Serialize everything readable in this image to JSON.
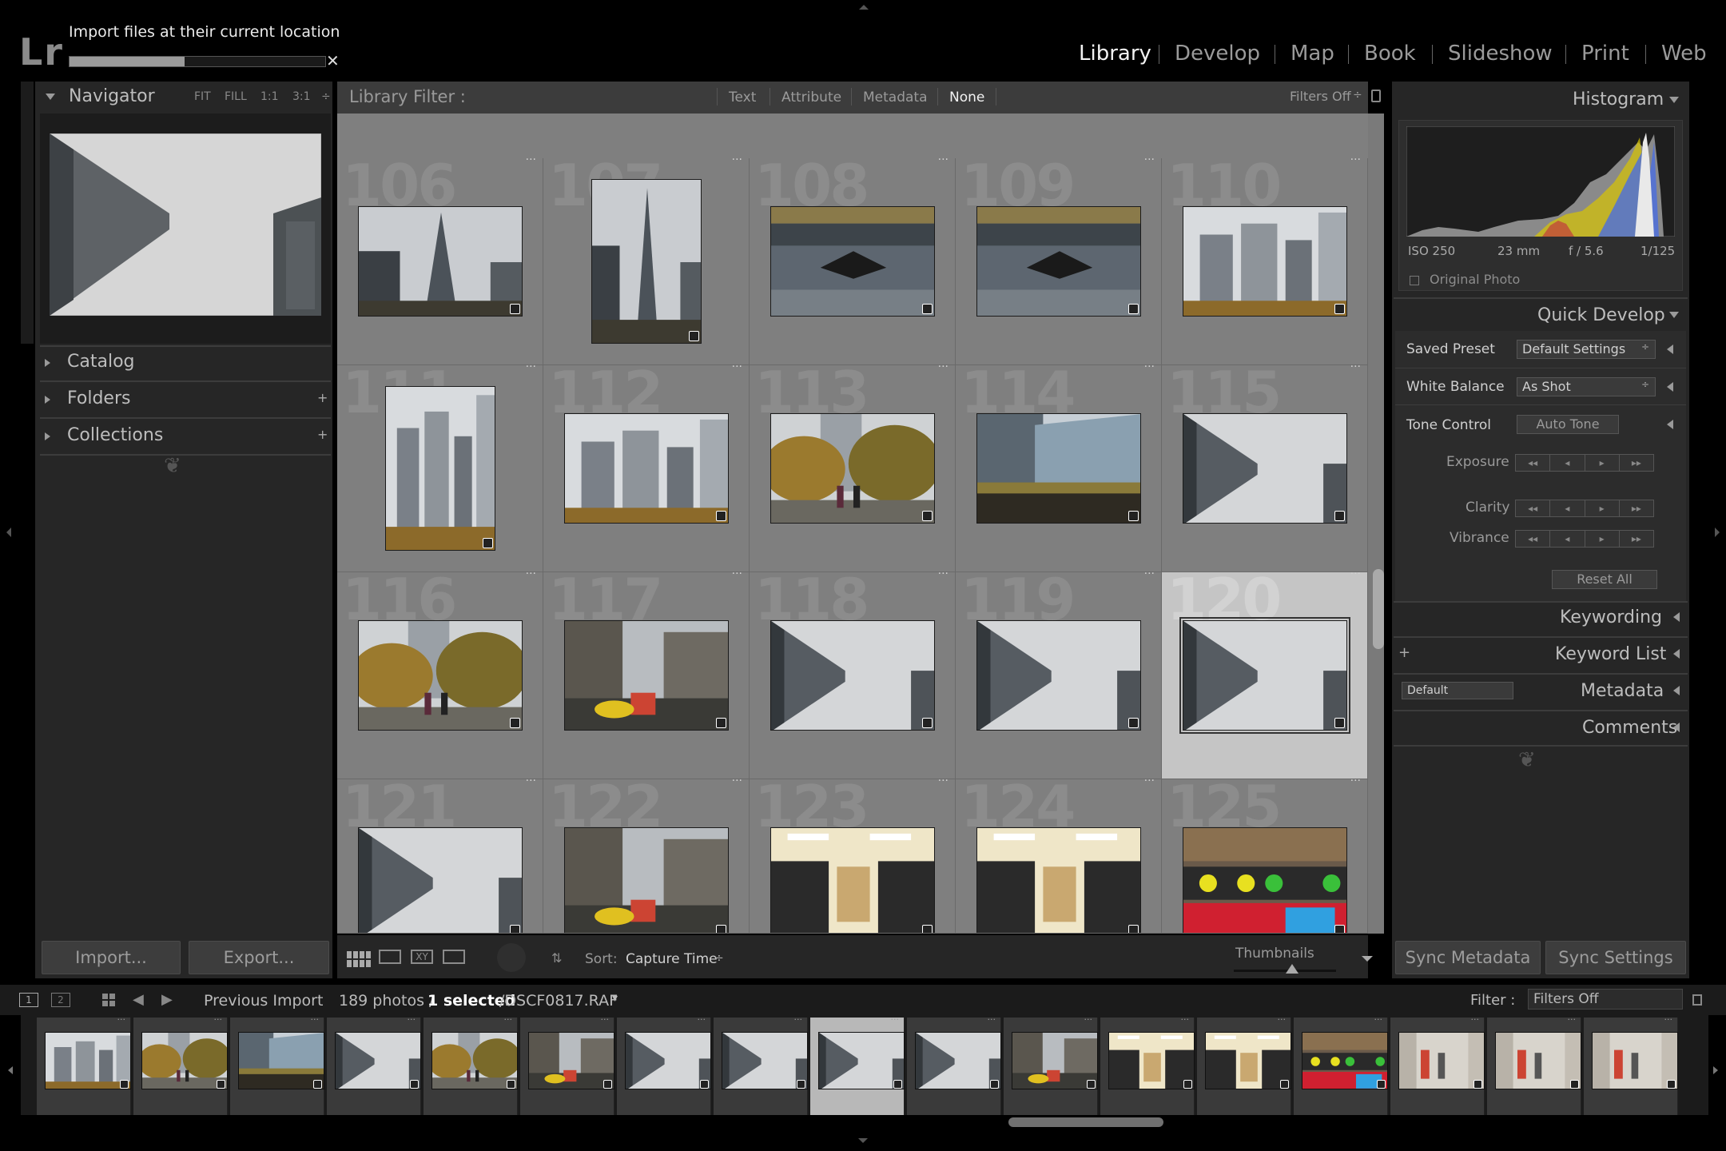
{
  "app": {
    "logo": "Lr"
  },
  "import": {
    "status": "Import files at their current location",
    "progress": 0.45,
    "close_label": "✕"
  },
  "modules": [
    "Library",
    "Develop",
    "Map",
    "Book",
    "Slideshow",
    "Print",
    "Web"
  ],
  "active_module": "Library",
  "left_panel": {
    "navigator": {
      "title": "Navigator",
      "zoom_options": [
        "FIT",
        "FILL",
        "1:1",
        "3:1"
      ]
    },
    "sections": [
      {
        "label": "Catalog",
        "add": ""
      },
      {
        "label": "Folders",
        "add": "+"
      },
      {
        "label": "Collections",
        "add": "+"
      }
    ],
    "ornament": "❦",
    "import_button": "Import...",
    "export_button": "Export..."
  },
  "library_filter": {
    "label": "Library Filter :",
    "options": [
      "Text",
      "Attribute",
      "Metadata",
      "None"
    ],
    "active": "None",
    "status": "Filters Off",
    "status_arrow": "÷"
  },
  "grid": {
    "rows": [
      [
        {
          "num": "106",
          "orient": "landscape",
          "style": "tower"
        },
        {
          "num": "107",
          "orient": "portrait",
          "style": "tower"
        },
        {
          "num": "108",
          "orient": "landscape",
          "style": "fountain"
        },
        {
          "num": "109",
          "orient": "landscape",
          "style": "fountain"
        },
        {
          "num": "110",
          "orient": "landscape",
          "style": "city"
        }
      ],
      [
        {
          "num": "111",
          "orient": "portrait",
          "style": "city"
        },
        {
          "num": "112",
          "orient": "landscape",
          "style": "city"
        },
        {
          "num": "113",
          "orient": "landscape",
          "style": "trees"
        },
        {
          "num": "114",
          "orient": "landscape",
          "style": "glass"
        },
        {
          "num": "115",
          "orient": "landscape",
          "style": "sky"
        }
      ],
      [
        {
          "num": "116",
          "orient": "landscape",
          "style": "trees"
        },
        {
          "num": "117",
          "orient": "landscape",
          "style": "street"
        },
        {
          "num": "118",
          "orient": "landscape",
          "style": "sky"
        },
        {
          "num": "119",
          "orient": "landscape",
          "style": "sky"
        },
        {
          "num": "120",
          "orient": "landscape",
          "style": "sky",
          "selected": true
        }
      ],
      [
        {
          "num": "121",
          "orient": "landscape",
          "style": "sky"
        },
        {
          "num": "122",
          "orient": "landscape",
          "style": "street"
        },
        {
          "num": "123",
          "orient": "landscape",
          "style": "store"
        },
        {
          "num": "124",
          "orient": "landscape",
          "style": "store"
        },
        {
          "num": "125",
          "orient": "landscape",
          "style": "shop"
        }
      ]
    ]
  },
  "toolbar": {
    "sort_label": "Sort:",
    "sort_value": "Capture Time",
    "sort_arrow": "÷",
    "thumbnails_label": "Thumbnails",
    "thumbnail_size": 0.4
  },
  "right_panel": {
    "histogram": {
      "title": "Histogram",
      "iso": "ISO 250",
      "focal": "23 mm",
      "aperture": "f / 5.6",
      "shutter": "1/125",
      "original_photo": "Original Photo"
    },
    "quick_develop": {
      "title": "Quick Develop",
      "saved_preset_label": "Saved Preset",
      "saved_preset_value": "Default Settings",
      "white_balance_label": "White Balance",
      "white_balance_value": "As Shot",
      "tone_control_label": "Tone Control",
      "auto_tone": "Auto Tone",
      "exposure": "Exposure",
      "clarity": "Clarity",
      "vibrance": "Vibrance",
      "reset_all": "Reset All"
    },
    "keywording": "Keywording",
    "keyword_list": "Keyword List",
    "keyword_add": "+",
    "metadata": {
      "title": "Metadata",
      "preset": "Default"
    },
    "comments": "Comments",
    "ornament": "❦",
    "sync_metadata": "Sync Metadata",
    "sync_settings": "Sync Settings"
  },
  "filmstrip_bar": {
    "view1": "1",
    "view2": "2",
    "source": "Previous Import",
    "count": "189 photos /",
    "selected": "1 selected",
    "filename": "/DSCF0817.RAF",
    "filename_arrow": "▾",
    "filter_label": "Filter :",
    "filter_value": "Filters Off"
  },
  "filmstrip": [
    {
      "style": "city"
    },
    {
      "style": "trees"
    },
    {
      "style": "glass"
    },
    {
      "style": "sky"
    },
    {
      "style": "trees"
    },
    {
      "style": "street"
    },
    {
      "style": "sky"
    },
    {
      "style": "sky"
    },
    {
      "style": "sky",
      "selected": true
    },
    {
      "style": "sky"
    },
    {
      "style": "street"
    },
    {
      "style": "store"
    },
    {
      "style": "store"
    },
    {
      "style": "shop"
    },
    {
      "style": "mall"
    },
    {
      "style": "mall"
    },
    {
      "style": "mall"
    }
  ]
}
